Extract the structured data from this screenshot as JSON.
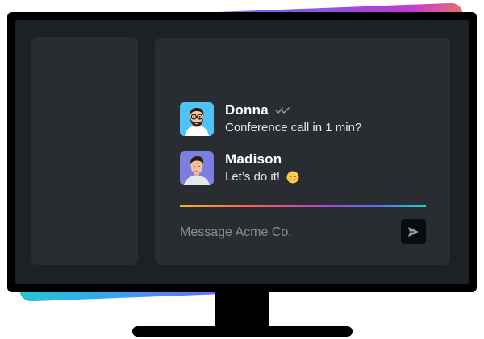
{
  "chat": {
    "messages": [
      {
        "author": "Donna",
        "text": "Conference call in 1 min?",
        "avatar": "man-glasses-beard-avatar",
        "status_icon": "double-check-icon"
      },
      {
        "author": "Madison",
        "text": "Let’s do it!",
        "avatar": "man-avatar",
        "emoji": "relieved-face-emoji-icon"
      }
    ],
    "composer": {
      "placeholder": "Message Acme Co.",
      "value": "",
      "send_icon": "send-icon"
    }
  },
  "colors": {
    "screen_bg": "#1e2124",
    "panel_bg": "#292c30",
    "avatar_blue": "#4fc3f7",
    "avatar_purple": "#7b7fdd",
    "send_button_bg": "#0b0c0d"
  }
}
